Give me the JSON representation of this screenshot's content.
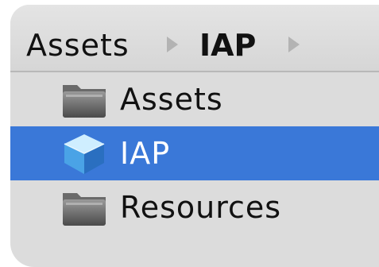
{
  "breadcrumb": {
    "items": [
      {
        "label": "Assets",
        "bold": false
      },
      {
        "label": "IAP",
        "bold": true
      }
    ]
  },
  "tree": {
    "items": [
      {
        "label": "Assets",
        "icon": "folder-icon",
        "selected": false
      },
      {
        "label": "IAP",
        "icon": "cube-icon",
        "selected": true
      },
      {
        "label": "Resources",
        "icon": "folder-icon",
        "selected": false
      }
    ]
  },
  "colors": {
    "selection": "#3a78d8",
    "panel": "#dcdcdc"
  }
}
